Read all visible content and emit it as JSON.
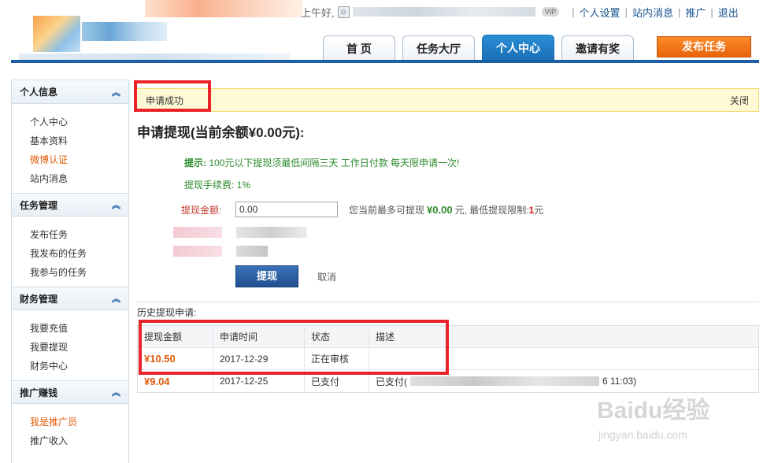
{
  "header": {
    "greeting": "上午好,",
    "vip_badge": "VIP",
    "links": [
      "个人设置",
      "站内消息",
      "推广",
      "退出"
    ],
    "nav_tabs": [
      {
        "label": "首 页",
        "active": false
      },
      {
        "label": "任务大厅",
        "active": false
      },
      {
        "label": "个人中心",
        "active": true
      },
      {
        "label": "邀请有奖",
        "active": false
      }
    ],
    "publish_label": "发布任务"
  },
  "sidebar": {
    "groups": [
      {
        "title": "个人信息",
        "items": [
          "个人中心",
          "基本资料",
          "微博认证",
          "站内消息"
        ],
        "highlight": "微博认证"
      },
      {
        "title": "任务管理",
        "items": [
          "发布任务",
          "我发布的任务",
          "我参与的任务"
        ],
        "highlight": ""
      },
      {
        "title": "财务管理",
        "items": [
          "我要充值",
          "我要提现",
          "财务中心"
        ],
        "highlight": ""
      },
      {
        "title": "推广赚钱",
        "items": [
          "我是推广员",
          "推广收入"
        ],
        "highlight": "我是推广员"
      }
    ]
  },
  "notice": {
    "text": "申请成功",
    "close_label": "关闭"
  },
  "withdraw": {
    "title": "申请提现(当前余额¥0.00元):",
    "tip_label": "提示:",
    "tip_text": "100元以下提现须最低间隔三天 工作日付款 每天限申请一次!",
    "fee_text": "提现手续费: 1%",
    "amount_label": "提现金额:",
    "amount_value": "0.00",
    "hint_prefix": "您当前最多可提现",
    "hint_max": "¥0.00",
    "hint_middle": "元, 最低提现限制:",
    "hint_min": "1",
    "hint_suffix": "元",
    "submit_label": "提现",
    "cancel_label": "取消"
  },
  "history": {
    "title": "历史提现申请:",
    "columns": [
      "提现金额",
      "申请时间",
      "状态",
      "描述"
    ],
    "rows": [
      {
        "amount": "¥10.50",
        "date": "2017-12-29",
        "status": "正在审核",
        "desc": ""
      },
      {
        "amount": "¥9.04",
        "date": "2017-12-25",
        "status": "已支付",
        "desc": "已支付(",
        "desc_tail": "6 11:03)"
      }
    ]
  },
  "watermark": {
    "brand": "Baidu经验",
    "url": "jingyan.baidu.com"
  },
  "colors": {
    "brand_blue": "#1c5fa5",
    "accent_orange": "#e9630b",
    "highlight_red": "#e8242a",
    "tip_green": "#2b8a2b"
  }
}
